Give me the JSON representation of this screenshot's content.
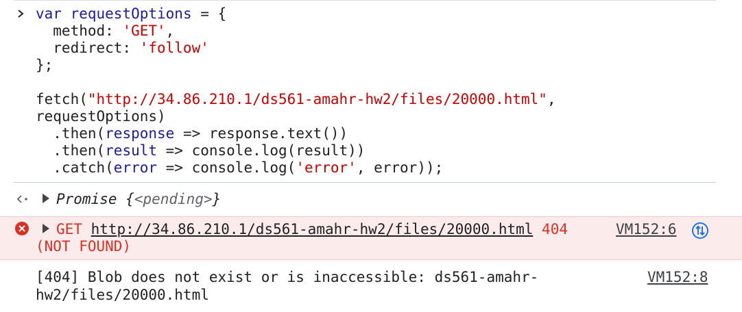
{
  "input": {
    "code_lines": [
      {
        "parts": [
          {
            "t": "var ",
            "c": "kw"
          },
          {
            "t": "requestOptions",
            "c": "var"
          },
          {
            "t": " = {",
            "c": "plain"
          }
        ]
      },
      {
        "parts": [
          {
            "t": "  method: ",
            "c": "plain"
          },
          {
            "t": "'GET'",
            "c": "str"
          },
          {
            "t": ",",
            "c": "plain"
          }
        ]
      },
      {
        "parts": [
          {
            "t": "  redirect: ",
            "c": "plain"
          },
          {
            "t": "'follow'",
            "c": "str"
          }
        ]
      },
      {
        "parts": [
          {
            "t": "};",
            "c": "plain"
          }
        ]
      },
      {
        "parts": [
          {
            "t": "",
            "c": "plain"
          }
        ]
      },
      {
        "parts": [
          {
            "t": "fetch(",
            "c": "plain"
          },
          {
            "t": "\"http://34.86.210.1/ds561-amahr-hw2/files/20000.html\"",
            "c": "str"
          },
          {
            "t": ",",
            "c": "plain"
          }
        ]
      },
      {
        "parts": [
          {
            "t": "requestOptions)",
            "c": "plain"
          }
        ]
      },
      {
        "parts": [
          {
            "t": "  .then(",
            "c": "plain"
          },
          {
            "t": "response",
            "c": "var"
          },
          {
            "t": " => response.text())",
            "c": "plain"
          }
        ]
      },
      {
        "parts": [
          {
            "t": "  .then(",
            "c": "plain"
          },
          {
            "t": "result",
            "c": "var"
          },
          {
            "t": " => console.log(result))",
            "c": "plain"
          }
        ]
      },
      {
        "parts": [
          {
            "t": "  .catch(",
            "c": "plain"
          },
          {
            "t": "error",
            "c": "var"
          },
          {
            "t": " => console.log(",
            "c": "plain"
          },
          {
            "t": "'error'",
            "c": "str"
          },
          {
            "t": ", error));",
            "c": "plain"
          }
        ]
      }
    ]
  },
  "result": {
    "label": "Promise",
    "open": "{",
    "pending": "<pending>",
    "close": "}"
  },
  "error": {
    "method": "GET",
    "url": "http://34.86.210.1/ds561-amahr-hw2/files/20000.html",
    "status": "404",
    "status_text": "(NOT FOUND)",
    "source": "VM152:6"
  },
  "log": {
    "line1": "[404] Blob does not exist or is inaccessible: ds561-amahr-",
    "line2": "hw2/files/20000.html",
    "source": "VM152:8"
  },
  "colors": {
    "keyword": "#1a1aa6",
    "string": "#c80000",
    "error_text": "#d93025",
    "error_bg": "#fcebeb",
    "net_icon": "#1a73e8"
  }
}
